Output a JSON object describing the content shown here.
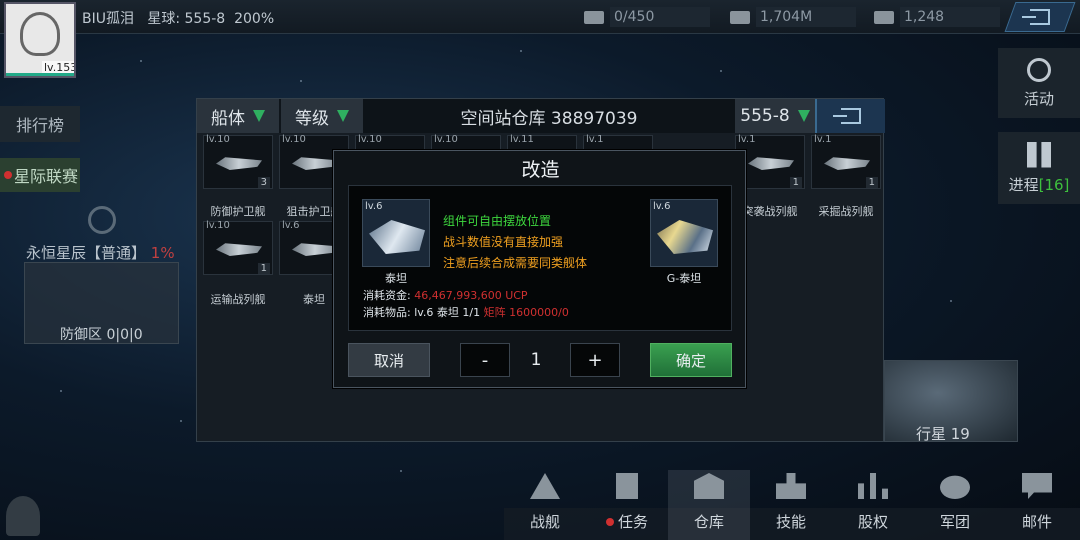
{
  "player": {
    "name": "BIU孤泪",
    "star": "星球: 555-8",
    "percent": "200%",
    "level": "lv.153"
  },
  "resources": [
    {
      "icon": "energy-icon",
      "value": "0/450"
    },
    {
      "icon": "money-icon",
      "value": "1,704M"
    },
    {
      "icon": "card-icon",
      "value": "1,248"
    }
  ],
  "left": {
    "rank": "排行榜",
    "league": "星际联赛",
    "eternal": "永恒星辰【普通】",
    "eternal_pct": "1%",
    "defense": "防御区 0|0|0"
  },
  "right": {
    "activity": "活动",
    "progress": "进程",
    "progress_count": "[16]",
    "planet": "行星 19"
  },
  "nav": [
    {
      "label": "战舰"
    },
    {
      "label": "任务",
      "dot": true
    },
    {
      "label": "仓库",
      "active": true
    },
    {
      "label": "技能"
    },
    {
      "label": "股权"
    },
    {
      "label": "军团"
    },
    {
      "label": "邮件"
    }
  ],
  "panel": {
    "filter1": "船体",
    "filter2": "等级",
    "title": "空间站仓库 38897039",
    "region": "555-8"
  },
  "slots": [
    {
      "lv": "lv.10",
      "count": "3",
      "label": "防御护卫舰"
    },
    {
      "lv": "lv.10",
      "count": "",
      "label": "狙击护卫舰"
    },
    {
      "lv": "lv.10",
      "count": "",
      "label": ""
    },
    {
      "lv": "lv.10",
      "count": "",
      "label": ""
    },
    {
      "lv": "lv.11",
      "count": "",
      "label": ""
    },
    {
      "lv": "lv.1",
      "count": "",
      "label": ""
    },
    {
      "lv": "lv.1",
      "count": "1",
      "label": "突袭战列舰"
    },
    {
      "lv": "lv.1",
      "count": "1",
      "label": "采掘战列舰"
    },
    {
      "lv": "lv.10",
      "count": "1",
      "label": "运输战列舰"
    },
    {
      "lv": "lv.6",
      "count": "",
      "label": "泰坦"
    }
  ],
  "modal": {
    "title": "改造",
    "from": {
      "lv": "lv.6",
      "name": "泰坦"
    },
    "to": {
      "lv": "lv.6",
      "name": "G-泰坦"
    },
    "notes": [
      {
        "text": "组件可自由摆放位置",
        "color": "#3ed83e"
      },
      {
        "text": "战斗数值没有直接加强",
        "color": "#f0a020"
      },
      {
        "text": "注意后续合成需要同类舰体",
        "color": "#f0a020"
      }
    ],
    "cost_fund_label": "消耗资金:",
    "cost_fund_value": "46,467,993,600 UCP",
    "cost_item_label": "消耗物品:",
    "cost_item_value": "lv.6 泰坦 1/1",
    "cost_matrix": "矩阵 1600000/0",
    "cancel": "取消",
    "minus": "-",
    "qty": "1",
    "plus": "+",
    "confirm": "确定"
  }
}
